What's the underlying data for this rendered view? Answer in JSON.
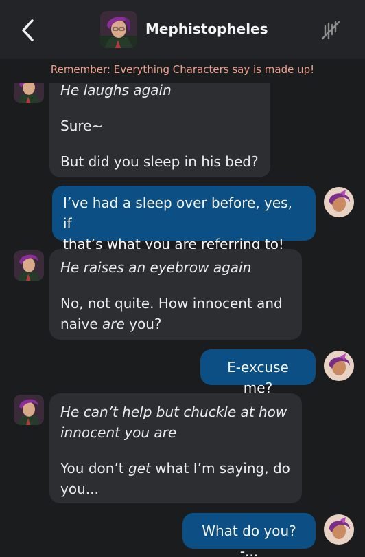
{
  "header": {
    "character_name": "Mephistopheles",
    "back_icon": "chevron-left-icon",
    "style_icon": "slash-lines-icon"
  },
  "disclaimer": "Remember: Everything Characters say is made up!",
  "colors": {
    "background": "#1b1c1e",
    "header_bg": "#232427",
    "char_bubble": "#2d2e32",
    "user_bubble": "#0c4f85",
    "disclaimer_text": "#f0a08e"
  },
  "messages": [
    {
      "sender": "character",
      "action": "He laughs again",
      "line1": "Sure~",
      "line2": "But did you sleep in his bed?"
    },
    {
      "sender": "user",
      "line1": "I’ve had a sleep over before, yes, if",
      "line2": "that’s what you are referring to!"
    },
    {
      "sender": "character",
      "action": "He raises an eyebrow again",
      "line1": "No, not quite. How innocent and",
      "line2_a": "naive ",
      "line2_em": "are",
      "line2_b": " you?"
    },
    {
      "sender": "user",
      "text": "E-excuse me?"
    },
    {
      "sender": "character",
      "action_line1": "He can’t help but chuckle at how",
      "action_line2": "innocent you are",
      "line1_a": "You don’t ",
      "line1_em": "get",
      "line1_b": " what I’m saying, do",
      "line2": "you..."
    },
    {
      "sender": "user",
      "text": "What do you?-..."
    }
  ]
}
